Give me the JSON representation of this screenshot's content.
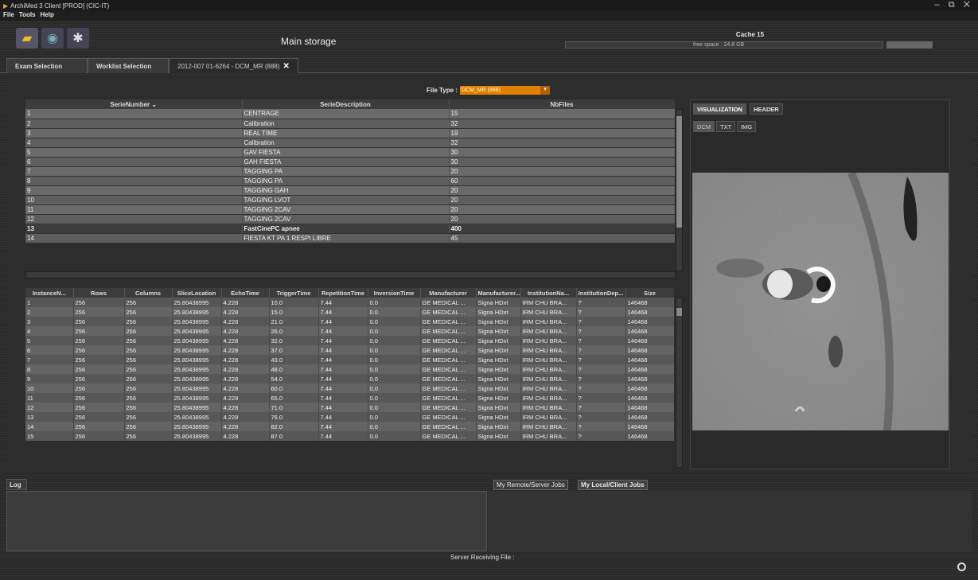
{
  "window": {
    "title": "ArchiMed 3 Client [PROD] (CIC-IT)",
    "controls": "– ⧉ ✕"
  },
  "menu": [
    "File",
    "Tools",
    "Help"
  ],
  "toolbar": {
    "storage_title": "Main storage"
  },
  "cache": {
    "label": "Cache 15",
    "free_space": "free space : 24.8 GB"
  },
  "tabs": [
    "Exam Selection",
    "Worklist Selection",
    "2012-007 01-6264 - DCM_MR (888)"
  ],
  "file_type": {
    "label": "File Type :",
    "value": "DCM_MR (888)"
  },
  "series": {
    "headers": [
      "SerieNumber",
      "SerieDescription",
      "NbFiles"
    ],
    "rows": [
      [
        "1",
        "CENTRAGE",
        "15"
      ],
      [
        "2",
        "Calibration",
        "32"
      ],
      [
        "3",
        "REAL TIME",
        "19"
      ],
      [
        "4",
        "Calibration",
        "32"
      ],
      [
        "5",
        "GAV FIESTA",
        "30"
      ],
      [
        "6",
        "GAH FIESTA",
        "30"
      ],
      [
        "7",
        "TAGGING PA",
        "20"
      ],
      [
        "8",
        "TAGGING PA",
        "60"
      ],
      [
        "9",
        "TAGGING GAH",
        "20"
      ],
      [
        "10",
        "TAGGING LVOT",
        "20"
      ],
      [
        "11",
        "TAGGING 2CAV",
        "20"
      ],
      [
        "12",
        "TAGGING 2CAV",
        "20"
      ],
      [
        "13",
        "FastCinePC apnee",
        "400"
      ],
      [
        "14",
        "FIESTA KT PA 1 RESPI LIBRE",
        "45"
      ]
    ],
    "selected_row": 12
  },
  "instances": {
    "headers": [
      "InstanceN...",
      "Rows",
      "Columns",
      "SliceLocation",
      "EchoTime",
      "TriggerTime",
      "RepetitionTime",
      "InversionTime",
      "Manufacturer",
      "Manufacturer...",
      "InstitutionNa...",
      "InstitutionDep...",
      "Size"
    ],
    "rows": [
      [
        "1",
        "256",
        "256",
        "25.80438995",
        "4.228",
        "10.0",
        "7.44",
        "0.0",
        "GE MEDICAL ...",
        "Signa HDxt",
        "IRM CHU BRA...",
        "?",
        "146468"
      ],
      [
        "2",
        "256",
        "256",
        "25.80438995",
        "4.228",
        "15.0",
        "7.44",
        "0.0",
        "GE MEDICAL ...",
        "Signa HDxt",
        "IRM CHU BRA...",
        "?",
        "146468"
      ],
      [
        "3",
        "256",
        "256",
        "25.80438995",
        "4.228",
        "21.0",
        "7.44",
        "0.0",
        "GE MEDICAL ...",
        "Signa HDxt",
        "IRM CHU BRA...",
        "?",
        "146468"
      ],
      [
        "4",
        "256",
        "256",
        "25.80438995",
        "4.228",
        "26.0",
        "7.44",
        "0.0",
        "GE MEDICAL ...",
        "Signa HDxt",
        "IRM CHU BRA...",
        "?",
        "146468"
      ],
      [
        "5",
        "256",
        "256",
        "25.80438995",
        "4.228",
        "32.0",
        "7.44",
        "0.0",
        "GE MEDICAL ...",
        "Signa HDxt",
        "IRM CHU BRA...",
        "?",
        "146468"
      ],
      [
        "6",
        "256",
        "256",
        "25.80438995",
        "4.228",
        "37.0",
        "7.44",
        "0.0",
        "GE MEDICAL ...",
        "Signa HDxt",
        "IRM CHU BRA...",
        "?",
        "146468"
      ],
      [
        "7",
        "256",
        "256",
        "25.80438995",
        "4.228",
        "43.0",
        "7.44",
        "0.0",
        "GE MEDICAL ...",
        "Signa HDxt",
        "IRM CHU BRA...",
        "?",
        "146468"
      ],
      [
        "8",
        "256",
        "256",
        "25.80438995",
        "4.228",
        "48.0",
        "7.44",
        "0.0",
        "GE MEDICAL ...",
        "Signa HDxt",
        "IRM CHU BRA...",
        "?",
        "146468"
      ],
      [
        "9",
        "256",
        "256",
        "25.80438995",
        "4.228",
        "54.0",
        "7.44",
        "0.0",
        "GE MEDICAL ...",
        "Signa HDxt",
        "IRM CHU BRA...",
        "?",
        "146468"
      ],
      [
        "10",
        "256",
        "256",
        "25.80438995",
        "4.228",
        "60.0",
        "7.44",
        "0.0",
        "GE MEDICAL ...",
        "Signa HDxt",
        "IRM CHU BRA...",
        "?",
        "146468"
      ],
      [
        "11",
        "256",
        "256",
        "25.80438995",
        "4.228",
        "65.0",
        "7.44",
        "0.0",
        "GE MEDICAL ...",
        "Signa HDxt",
        "IRM CHU BRA...",
        "?",
        "146468"
      ],
      [
        "12",
        "256",
        "256",
        "25.80438995",
        "4.228",
        "71.0",
        "7.44",
        "0.0",
        "GE MEDICAL ...",
        "Signa HDxt",
        "IRM CHU BRA...",
        "?",
        "146468"
      ],
      [
        "13",
        "256",
        "256",
        "25.80438995",
        "4.228",
        "76.0",
        "7.44",
        "0.0",
        "GE MEDICAL ...",
        "Signa HDxt",
        "IRM CHU BRA...",
        "?",
        "146468"
      ],
      [
        "14",
        "256",
        "256",
        "25.80438995",
        "4.228",
        "82.0",
        "7.44",
        "0.0",
        "GE MEDICAL ...",
        "Signa HDxt",
        "IRM CHU BRA...",
        "?",
        "146468"
      ],
      [
        "15",
        "256",
        "256",
        "25.80438995",
        "4.228",
        "87.0",
        "7.44",
        "0.0",
        "GE MEDICAL ...",
        "Signa HDxt",
        "IRM CHU BRA...",
        "?",
        "146468"
      ]
    ]
  },
  "viewer": {
    "tabs": [
      "VISUALIZATION",
      "HEADER"
    ],
    "subtabs": [
      "DCM",
      "TXT",
      "IMG"
    ]
  },
  "bottom": {
    "log_tab": "Log",
    "job_tabs": [
      "My Remote/Server Jobs",
      "My Local/Client Jobs"
    ],
    "status": "Server Receiving File :"
  },
  "colors": {
    "file_type_accent": "#e08000"
  }
}
